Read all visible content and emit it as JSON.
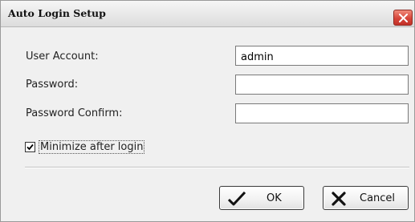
{
  "window": {
    "title": "Auto Login Setup"
  },
  "form": {
    "user_account": {
      "label": "User Account:",
      "value": "admin"
    },
    "password": {
      "label": "Password:",
      "value": ""
    },
    "password_confirm": {
      "label": "Password Confirm:",
      "value": ""
    }
  },
  "options": {
    "minimize_label": "Minimize after login",
    "minimize_checked": true
  },
  "buttons": {
    "ok_label": "OK",
    "cancel_label": "Cancel"
  },
  "icons": {
    "close": "close-icon",
    "ok": "checkmark-icon",
    "cancel": "x-icon"
  },
  "colors": {
    "close_button": "#d6453a",
    "dialog_background": "#f0f0f0"
  }
}
